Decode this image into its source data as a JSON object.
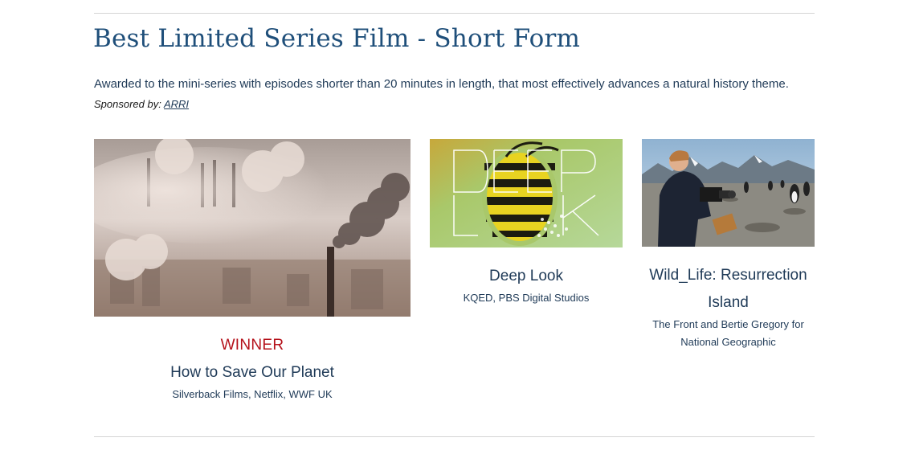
{
  "section": {
    "title": "Best Limited Series Film - Short Form",
    "description": "Awarded to the mini-series with episodes shorter than 20 minutes in length, that most effectively advances a natural history theme.",
    "sponsor_prefix": "Sponsored by:",
    "sponsor_name": "ARRI"
  },
  "entries": [
    {
      "badge": "WINNER",
      "title": "How to Save Our Planet",
      "credit": "Silverback Films, Netflix, WWF UK",
      "image_icon": "smokestacks-pollution-image"
    },
    {
      "title": "Deep Look",
      "credit": "KQED, PBS Digital Studios",
      "image_icon": "wasp-macro-image",
      "image_text": "DEEP LOOK"
    },
    {
      "title": "Wild_Life: Resurrection Island",
      "credit": "The Front and Bertie Gregory for National Geographic",
      "image_icon": "cameraman-penguins-image"
    }
  ],
  "colors": {
    "heading": "#1f4f7a",
    "text": "#1f3a57",
    "winner": "#b5121b",
    "divider": "#d4d4d4"
  }
}
